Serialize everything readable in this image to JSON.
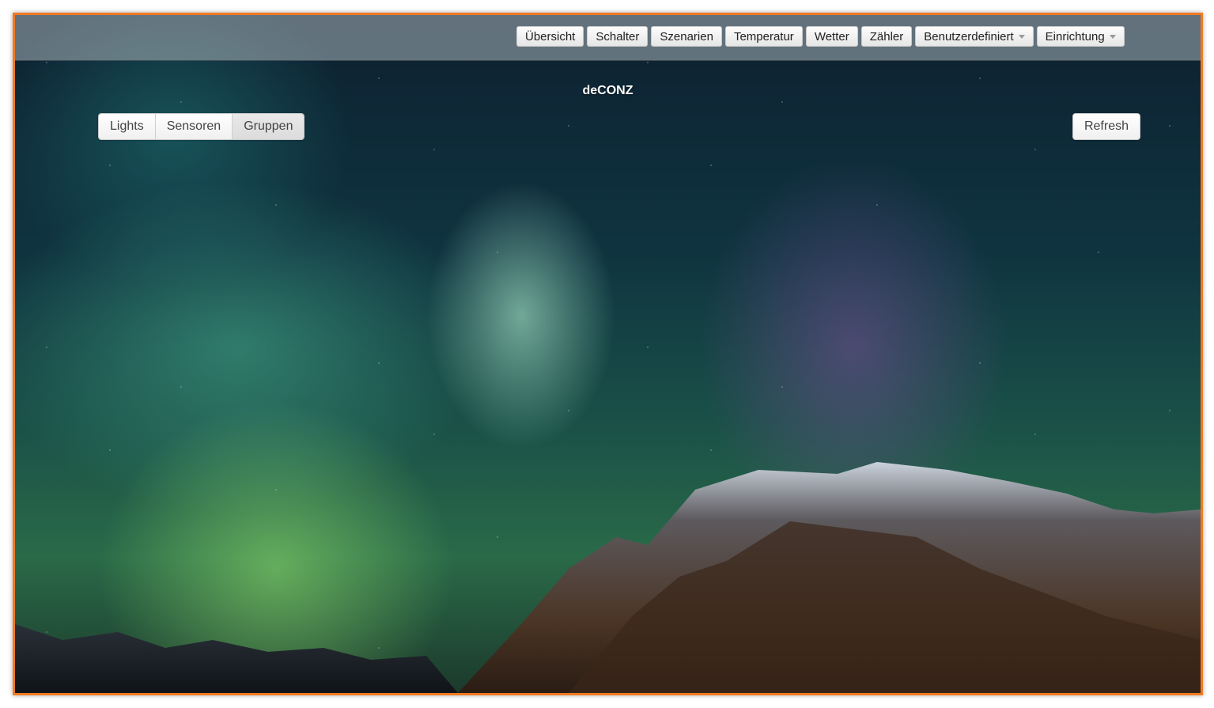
{
  "nav": {
    "items": [
      {
        "label": "Übersicht",
        "dropdown": false
      },
      {
        "label": "Schalter",
        "dropdown": false
      },
      {
        "label": "Szenarien",
        "dropdown": false
      },
      {
        "label": "Temperatur",
        "dropdown": false
      },
      {
        "label": "Wetter",
        "dropdown": false
      },
      {
        "label": "Zähler",
        "dropdown": false
      },
      {
        "label": "Benutzerdefiniert",
        "dropdown": true
      },
      {
        "label": "Einrichtung",
        "dropdown": true
      }
    ]
  },
  "page": {
    "title": "deCONZ"
  },
  "tabs": {
    "items": [
      {
        "label": "Lights",
        "active": false
      },
      {
        "label": "Sensoren",
        "active": false
      },
      {
        "label": "Gruppen",
        "active": true
      }
    ]
  },
  "actions": {
    "refresh_label": "Refresh"
  },
  "colors": {
    "frame_border": "#f07a22",
    "title_text": "#ffffff"
  },
  "icons": {
    "dropdown": "chevron-down-icon"
  }
}
